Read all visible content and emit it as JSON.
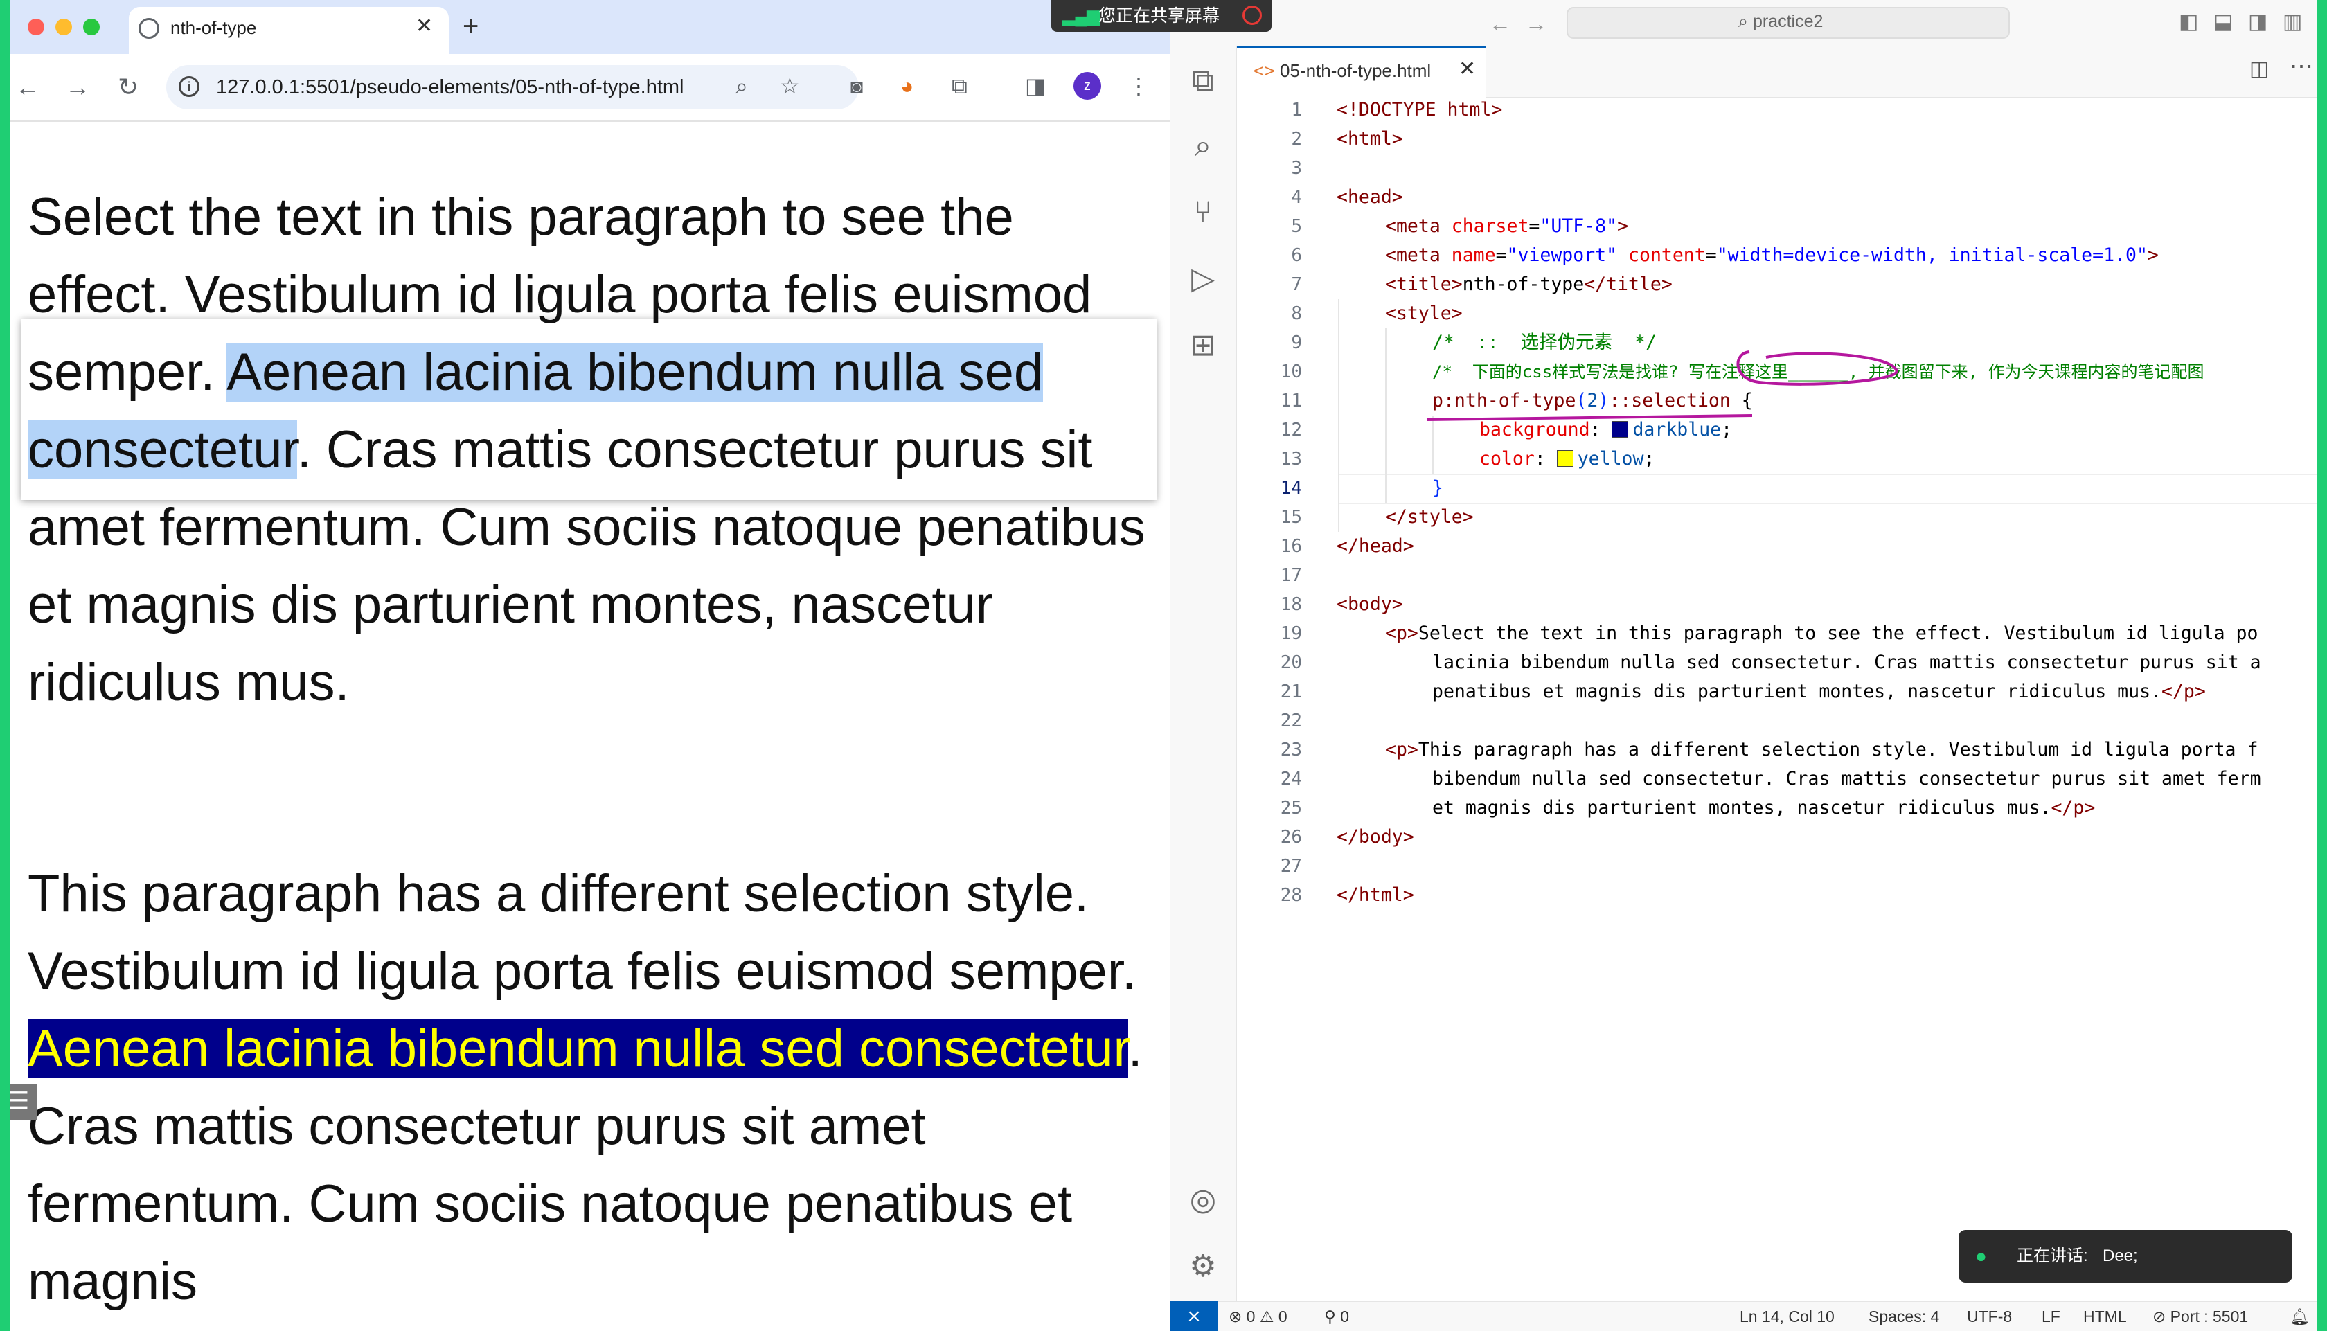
{
  "browser": {
    "tab_title": "nth-of-type",
    "tab_close": "✕",
    "new_tab": "+",
    "url": "127.0.0.1:5501/pseudo-elements/05-nth-of-type.html",
    "profile_initial": "z",
    "nav": {
      "back": "←",
      "forward": "→",
      "reload": "↻"
    }
  },
  "page": {
    "p1": {
      "before": "Select the text in this paragraph to see the effect. Vestibulum id ligula porta felis euismod semper. ",
      "selected": "Aenean lacinia bibendum nulla sed consectetur",
      "after": ". Cras mattis consectetur purus sit amet fermentum. Cum sociis natoque penatibus et magnis dis parturient montes, nascetur ridiculus mus."
    },
    "p2": {
      "before": "This paragraph has a different selection style. Vestibulum id ligula porta felis euismod semper. ",
      "selected": "Aenean lacinia bibendum nulla sed consectetur",
      "after": ". Cras mattis consectetur purus sit amet fermentum. Cum sociis natoque penatibus et magnis"
    },
    "selection_colors": {
      "default_bg": "#b3d3f8",
      "custom_bg": "#00008b",
      "custom_fg": "#ffff00"
    }
  },
  "share_banner": "您正在共享屏幕",
  "vscode": {
    "search_placeholder": "practice2",
    "tab_title": "05-nth-of-type.html",
    "code": {
      "l1a": "<!DOCTYPE ",
      "l1b": "html",
      "l1c": ">",
      "l2": "<html>",
      "l4": "<head>",
      "l5a": "<meta ",
      "l5b": "charset",
      "l5c": "=",
      "l5d": "\"UTF-8\"",
      "l5e": ">",
      "l6a": "<meta ",
      "l6b": "name",
      "l6c": "=",
      "l6d": "\"viewport\"",
      "l6e": " content",
      "l6f": "=",
      "l6g": "\"width=device-width, initial-scale=1.0\"",
      "l6h": ">",
      "l7a": "<title>",
      "l7b": "nth-of-type",
      "l7c": "</title>",
      "l8": "<style>",
      "l9": "/*  ::  选择伪元素  */",
      "l10": "/*  下面的css样式写法是找谁? 写在注释这里______, 并截图留下来, 作为今天课程内容的笔记配图",
      "l11a": "p:nth-of-type",
      "l11b": "(",
      "l11c": "2",
      "l11d": ")",
      "l11e": "::selection",
      "l11f": " {",
      "l12a": "background",
      "l12b": ": ",
      "l12c": "darkblue",
      "l12d": ";",
      "l13a": "color",
      "l13b": ": ",
      "l13c": "yellow",
      "l13d": ";",
      "l14": "}",
      "l15": "</style>",
      "l16": "</head>",
      "l18": "<body>",
      "l19a": "<p>",
      "l19b": "Select the text in this paragraph to see the effect. Vestibulum id ligula po",
      "l20": "lacinia bibendum nulla sed consectetur. Cras mattis consectetur purus sit a",
      "l21a": "penatibus et magnis dis parturient montes, nascetur ridiculus mus.",
      "l21b": "</p>",
      "l23a": "<p>",
      "l23b": "This paragraph has a different selection style. Vestibulum id ligula porta f",
      "l24": "bibendum nulla sed consectetur. Cras mattis consectetur purus sit amet ferm",
      "l25a": "et magnis dis parturient montes, nascetur ridiculus mus.",
      "l25b": "</p>",
      "l26": "</body>",
      "l28": "</html>"
    },
    "line_numbers": [
      "1",
      "2",
      "3",
      "4",
      "5",
      "6",
      "7",
      "8",
      "9",
      "10",
      "11",
      "12",
      "13",
      "14",
      "15",
      "16",
      "17",
      "18",
      "19",
      "20",
      "21",
      "22",
      "23",
      "24",
      "25",
      "26",
      "27",
      "28"
    ],
    "status": {
      "problems": "⊗ 0 ⚠ 0",
      "ports": "⚲ 0",
      "position": "Ln 14, Col 10",
      "spaces": "Spaces: 4",
      "encoding": "UTF-8",
      "eol": "LF",
      "language": "HTML",
      "port": "⊘ Port : 5501"
    },
    "speaking_label": "正在讲话:",
    "speaking_name": "Dee;"
  }
}
